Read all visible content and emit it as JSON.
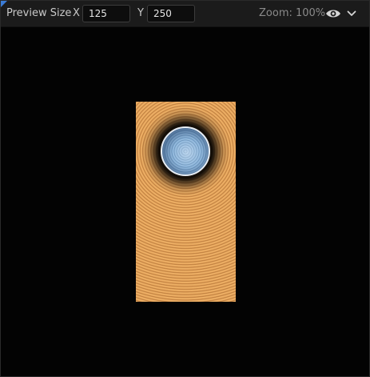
{
  "toolbar": {
    "preview_size_label": "Preview Size",
    "x_label": "X",
    "x_value": "125",
    "y_label": "Y",
    "y_value": "250",
    "zoom_label": "Zoom: 100%",
    "visibility_icon": "eye-icon",
    "dropdown_icon": "chevron-down-icon"
  },
  "preview": {
    "background_color": "#e2a057",
    "sphere_color": "#7ea8cf"
  },
  "colors": {
    "toolbar_bg": "#1b1b1b",
    "viewport_bg": "#030303",
    "accent": "#3a7bd5"
  }
}
